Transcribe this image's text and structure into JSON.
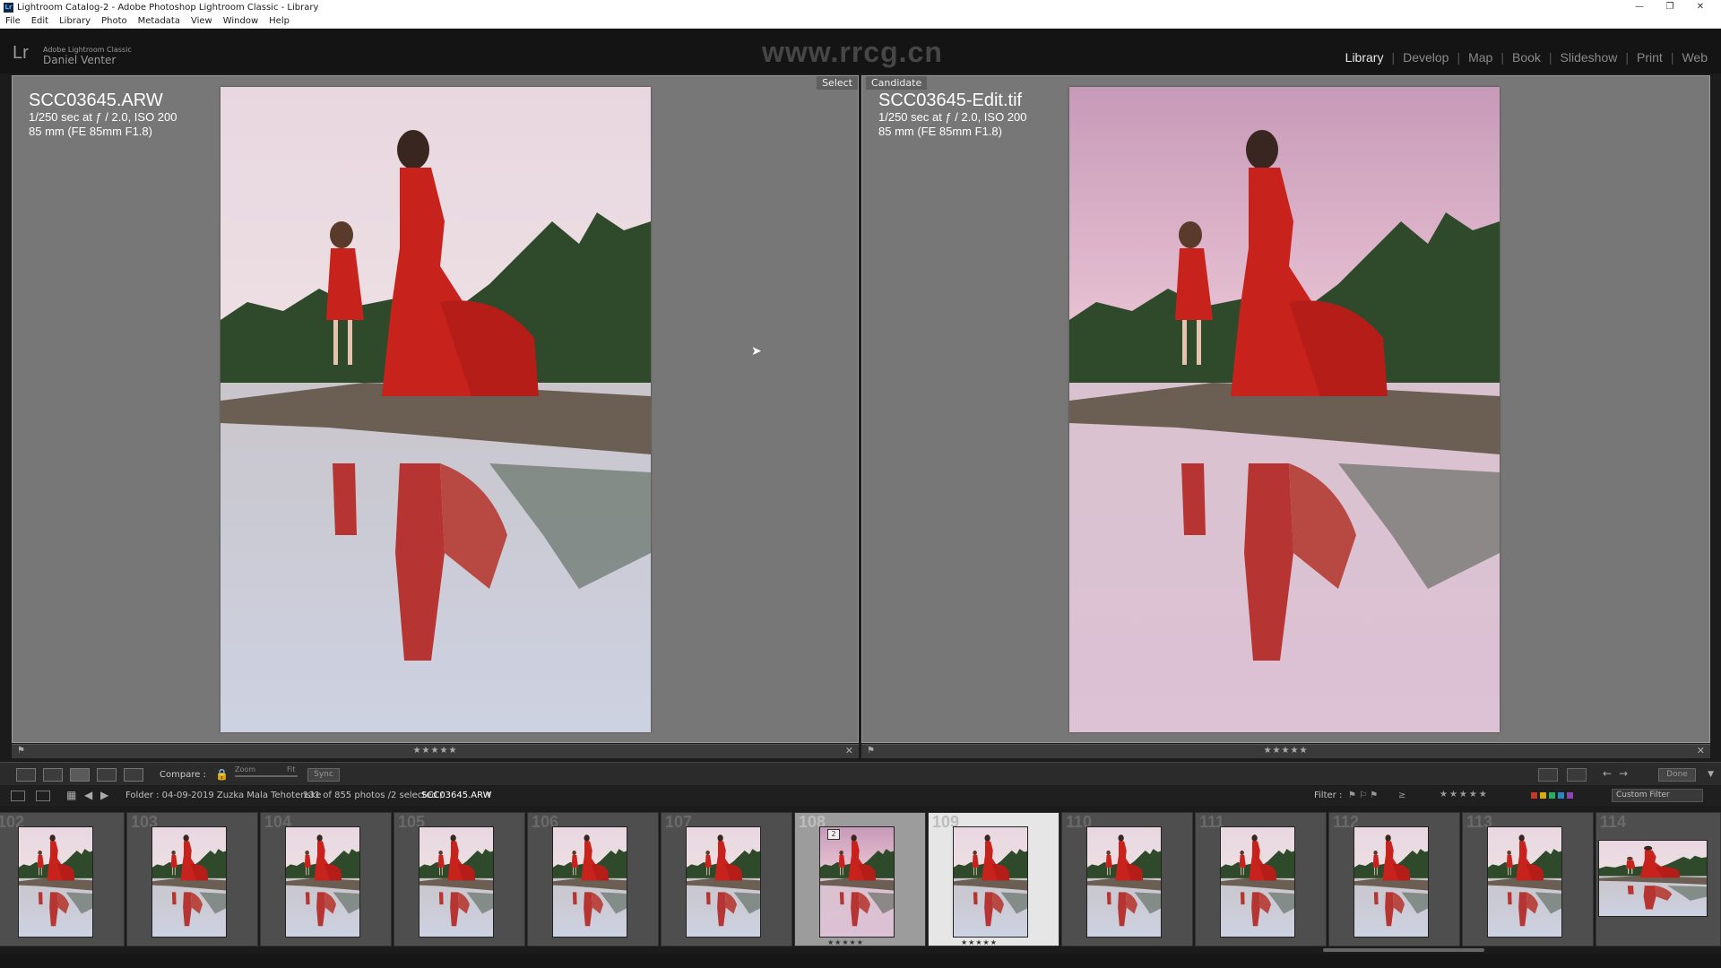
{
  "window": {
    "title": "Lightroom Catalog-2 - Adobe Photoshop Lightroom Classic - Library",
    "app_icon": "Lr"
  },
  "menu": [
    "File",
    "Edit",
    "Library",
    "Photo",
    "Metadata",
    "View",
    "Window",
    "Help"
  ],
  "identity": {
    "logo": "Lr",
    "product": "Adobe Lightroom Classic",
    "user": "Daniel Venter"
  },
  "modules": [
    {
      "label": "Library",
      "active": true
    },
    {
      "label": "Develop",
      "active": false
    },
    {
      "label": "Map",
      "active": false
    },
    {
      "label": "Book",
      "active": false
    },
    {
      "label": "Slideshow",
      "active": false
    },
    {
      "label": "Print",
      "active": false
    },
    {
      "label": "Web",
      "active": false
    }
  ],
  "watermark": "www.rrcg.cn",
  "compare": {
    "select": {
      "badge": "Select",
      "filename": "SCC03645.ARW",
      "exposure": "1/250 sec at ƒ / 2.0, ISO 200",
      "lens": "85 mm (FE 85mm F1.8)",
      "stars": "★★★★★"
    },
    "candidate": {
      "badge": "Candidate",
      "filename": "SCC03645-Edit.tif",
      "exposure": "1/250 sec at ƒ / 2.0, ISO 200",
      "lens": "85 mm (FE 85mm F1.8)",
      "stars": "★★★★★"
    }
  },
  "toolbar": {
    "compare_label": "Compare :",
    "zoom_label": "Zoom",
    "fit_label": "Fit",
    "sync_label": "Sync",
    "done_label": "Done"
  },
  "filmstrip_header": {
    "folder": "Folder : 04-09-2019 Zuzka Mala Tehotenske",
    "count": "131 of 855 photos /2 selected /",
    "current": "SCC03645.ARW",
    "filter_label": "Filter :",
    "filter_stars": "★★★★★",
    "custom_filter": "Custom Filter",
    "label_colors": [
      "#c0392b",
      "#d4ac0d",
      "#27ae60",
      "#2e86c1",
      "#8e44ad"
    ]
  },
  "filmstrip": [
    {
      "num": "102",
      "state": "normal"
    },
    {
      "num": "103",
      "state": "normal"
    },
    {
      "num": "104",
      "state": "normal"
    },
    {
      "num": "105",
      "state": "normal"
    },
    {
      "num": "106",
      "state": "normal"
    },
    {
      "num": "107",
      "state": "normal"
    },
    {
      "num": "108",
      "state": "selected",
      "stack": "2",
      "rating": "★★★★★"
    },
    {
      "num": "109",
      "state": "active",
      "rating": "★★★★★"
    },
    {
      "num": "110",
      "state": "normal"
    },
    {
      "num": "111",
      "state": "normal"
    },
    {
      "num": "112",
      "state": "normal"
    },
    {
      "num": "113",
      "state": "normal"
    },
    {
      "num": "114",
      "state": "normal"
    }
  ]
}
